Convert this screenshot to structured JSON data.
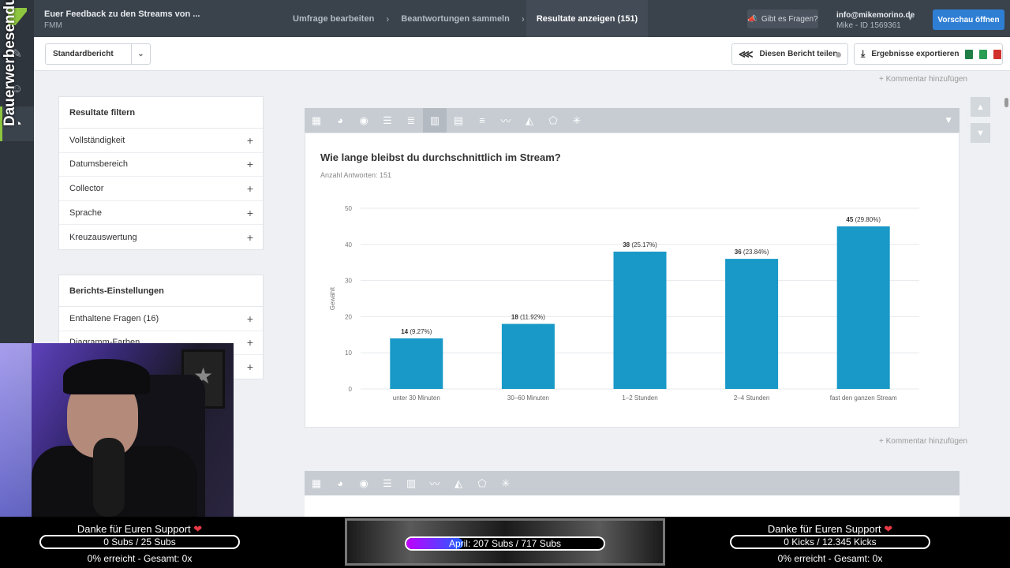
{
  "watermark": "Dauerwerbesendung",
  "topbar": {
    "survey_title": "Euer Feedback zu den Streams von ...",
    "survey_sub": "FMM",
    "steps": [
      "Umfrage bearbeiten",
      "Beantwortungen sammeln",
      "Resultate anzeigen (151)"
    ],
    "help_label": "Gibt es Fragen?",
    "user_email": "info@mikemorino.de",
    "user_id": "Mike - ID 1569361",
    "preview_label": "Vorschau öffnen"
  },
  "toolbar": {
    "report_select": "Standardbericht",
    "share_label": "Diesen Bericht teilen",
    "export_label": "Ergebnisse exportieren"
  },
  "comment_link": "+ Kommentar hinzufügen",
  "filter_panel": {
    "title": "Resultate filtern",
    "items": [
      "Vollständigkeit",
      "Datumsbereich",
      "Collector",
      "Sprache",
      "Kreuzauswertung"
    ]
  },
  "settings_panel": {
    "title": "Berichts-Einstellungen",
    "items": [
      "Enthaltene Fragen (16)",
      "Diagramm-Farben",
      ""
    ]
  },
  "question": {
    "title": "Wie lange bleibst du durchschnittlich im Stream?",
    "count": "Anzahl Antworten: 151"
  },
  "chart_data": {
    "type": "bar",
    "categories": [
      "unter 30 Minuten",
      "30–60 Minuten",
      "1–2 Stunden",
      "2–4 Stunden",
      "fast den ganzen Stream"
    ],
    "values": [
      14,
      18,
      38,
      36,
      45
    ],
    "percent_labels": [
      "(9.27%)",
      "(11.92%)",
      "(25.17%)",
      "(23.84%)",
      "(29.80%)"
    ],
    "ylabel": "Gewählt",
    "ylim": [
      0,
      50
    ],
    "yticks": [
      0,
      10,
      20,
      30,
      40,
      50
    ],
    "grid": true,
    "bar_color": "#1899c8"
  },
  "overlay": {
    "left": {
      "thanks": "Danke für Euren Support",
      "bar": "0 Subs / 25 Subs",
      "reached": "0% erreicht - Gesamt: 0x"
    },
    "center": {
      "bar": "April: 207 Subs / 717 Subs",
      "progress": 0.289
    },
    "right": {
      "thanks": "Danke für Euren Support",
      "bar": "0 Kicks / 12.345 Kicks",
      "reached": "0% erreicht - Gesamt: 0x"
    }
  },
  "colors": {
    "accent": "#8dc63f",
    "primary": "#2e7fd4",
    "bar": "#1899c8"
  }
}
